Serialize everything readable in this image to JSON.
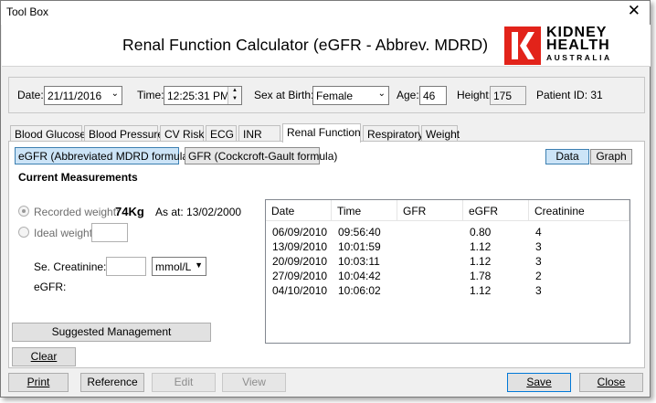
{
  "window": {
    "title": "Tool Box",
    "close_glyph": "✕"
  },
  "header": {
    "app_title": "Renal Function Calculator (eGFR - Abbrev. MDRD)",
    "logo": {
      "line1": "KIDNEY",
      "line2": "HEALTH",
      "line3": "AUSTRALIA",
      "color": "#e2231a",
      "icon": "kidney-health-logo"
    }
  },
  "patient": {
    "date_label": "Date:",
    "date_value": "21/11/2016",
    "time_label": "Time:",
    "time_value": "12:25:31 PM",
    "sex_label": "Sex at Birth:",
    "sex_value": "Female",
    "age_label": "Age:",
    "age_value": "46",
    "height_label": "Height:",
    "height_value": "175",
    "patient_id_text": "Patient ID: 31"
  },
  "tabs": [
    {
      "label": "Blood Glucose"
    },
    {
      "label": "Blood Pressure"
    },
    {
      "label": "CV Risk"
    },
    {
      "label": "ECG"
    },
    {
      "label": "INR"
    },
    {
      "label": "Renal Function",
      "active": true
    },
    {
      "label": "Respiratory"
    },
    {
      "label": "Weight"
    }
  ],
  "subtabs": [
    {
      "label": "eGFR (Abbreviated MDRD formula)",
      "active": true
    },
    {
      "label": "GFR (Cockcroft-Gault formula)"
    }
  ],
  "view_buttons": [
    {
      "label": "Data",
      "active": true
    },
    {
      "label": "Graph"
    }
  ],
  "measurements": {
    "title": "Current Measurements",
    "recorded_weight_label": "Recorded weight:",
    "recorded_weight_value": "74Kg",
    "as_at_text": "As at: 13/02/2000",
    "ideal_weight_label": "Ideal weight:",
    "creatinine_label": "Se. Creatinine:",
    "creatinine_unit": "mmol/L",
    "egfr_label": "eGFR:"
  },
  "grid": {
    "columns": [
      "Date",
      "Time",
      "GFR",
      "eGFR",
      "Creatinine"
    ],
    "rows": [
      [
        "06/09/2010",
        "09:56:40",
        "",
        "0.80",
        "4"
      ],
      [
        "13/09/2010",
        "10:01:59",
        "",
        "1.12",
        "3"
      ],
      [
        "20/09/2010",
        "10:03:11",
        "",
        "1.12",
        "3"
      ],
      [
        "27/09/2010",
        "10:04:42",
        "",
        "1.78",
        "2"
      ],
      [
        "04/10/2010",
        "10:06:02",
        "",
        "1.12",
        "3"
      ]
    ]
  },
  "actions": {
    "suggested_management": "Suggested Management",
    "clear": "Clear"
  },
  "footer": {
    "print": "Print",
    "reference": "Reference",
    "edit": "Edit",
    "view": "View",
    "save": "Save",
    "close": "Close"
  },
  "colors": {
    "accent": "#cce4f7",
    "accent_border": "#3c7fb1",
    "window_bg": "#f0f0f0"
  }
}
